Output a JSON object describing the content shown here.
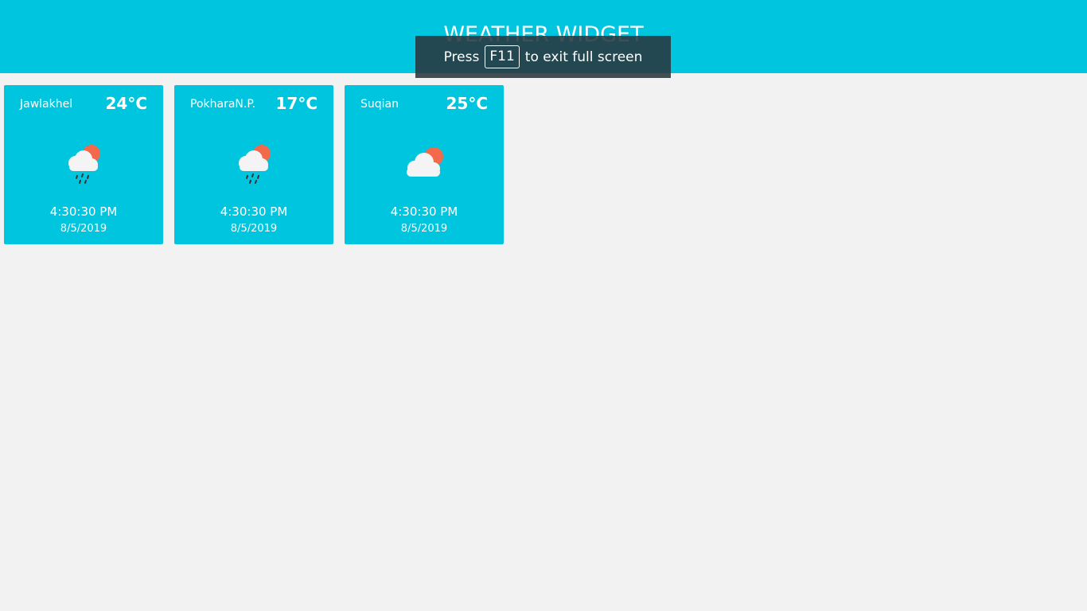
{
  "header": {
    "title": "WEATHER WIDGET"
  },
  "fullscreen_notice": {
    "prefix": "Press",
    "key": "F11",
    "suffix": "to exit full screen"
  },
  "cards": [
    {
      "city": "Jawlakhel",
      "temp": "24°C",
      "icon": "rain-cloud-sun-icon",
      "time": "4:30:30 PM",
      "date": "8/5/2019"
    },
    {
      "city": "PokharaN.P.",
      "temp": "17°C",
      "icon": "rain-cloud-sun-icon",
      "time": "4:30:30 PM",
      "date": "8/5/2019"
    },
    {
      "city": "Suqian",
      "temp": "25°C",
      "icon": "cloud-sun-icon",
      "time": "4:30:30 PM",
      "date": "8/5/2019"
    }
  ],
  "colors": {
    "header_bg": "#00c5df",
    "card_bg": "#00c5df",
    "page_bg": "#f2f2f2",
    "sun": "#f26a4b",
    "cloud": "#f4f4f4",
    "rain": "#333333"
  }
}
